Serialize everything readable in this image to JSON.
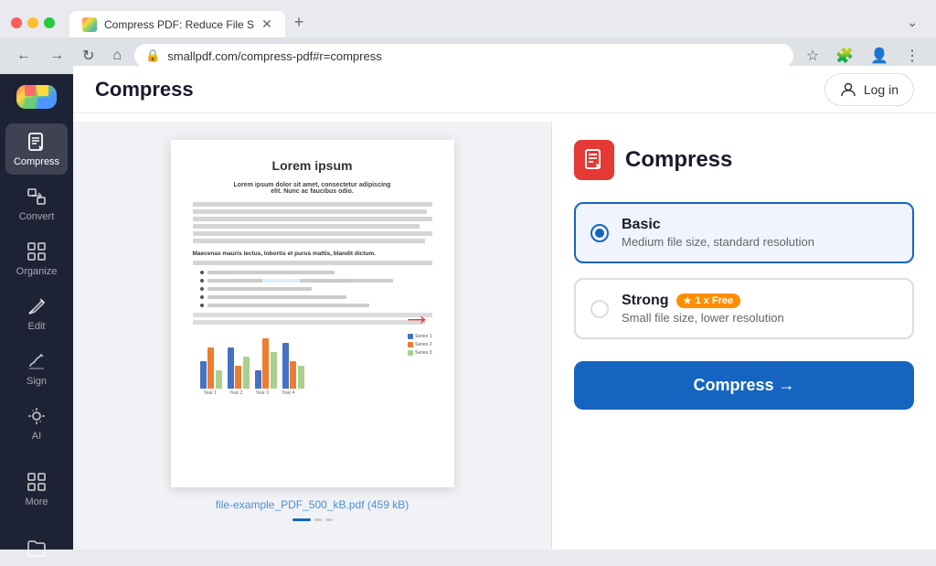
{
  "browser": {
    "tab_title": "Compress PDF: Reduce File S",
    "tab_new_label": "+",
    "url": "smallpdf.com/compress-pdf#r=compress",
    "nav": {
      "back": "←",
      "forward": "→",
      "refresh": "↻",
      "home": "⌂"
    },
    "dropdown_icon": "⌄"
  },
  "header": {
    "title": "Compress",
    "login_label": "Log in"
  },
  "sidebar": {
    "items": [
      {
        "id": "compress",
        "label": "Compress",
        "active": true
      },
      {
        "id": "convert",
        "label": "Convert",
        "active": false
      },
      {
        "id": "organize",
        "label": "Organize",
        "active": false
      },
      {
        "id": "edit",
        "label": "Edit",
        "active": false
      },
      {
        "id": "sign",
        "label": "Sign",
        "active": false
      },
      {
        "id": "ai",
        "label": "AI",
        "active": false
      },
      {
        "id": "more",
        "label": "More",
        "active": false
      },
      {
        "id": "files",
        "label": "",
        "active": false
      }
    ]
  },
  "pdf": {
    "title": "Lorem ipsum",
    "subtitle": "Lorem ipsum dolor sit amet, consectetur adipiscing elit. Nunc ac faucibus odio.",
    "filename": "file-example_PDF_500_kB.pdf (459 kB)"
  },
  "compress": {
    "icon_label": "compress-icon",
    "title": "Compress",
    "options": [
      {
        "id": "basic",
        "label": "Basic",
        "description": "Medium file size, standard resolution",
        "selected": true,
        "badge": null
      },
      {
        "id": "strong",
        "label": "Strong",
        "description": "Small file size, lower resolution",
        "selected": false,
        "badge": "★1 x Free"
      }
    ],
    "button_label": "Compress →"
  },
  "chart": {
    "groups": [
      {
        "bars": [
          {
            "color": "#4472c4",
            "height": 30
          },
          {
            "color": "#ed7d31",
            "height": 45
          },
          {
            "color": "#a9d18e",
            "height": 20
          }
        ]
      },
      {
        "bars": [
          {
            "color": "#4472c4",
            "height": 45
          },
          {
            "color": "#ed7d31",
            "height": 25
          },
          {
            "color": "#a9d18e",
            "height": 35
          }
        ]
      },
      {
        "bars": [
          {
            "color": "#4472c4",
            "height": 20
          },
          {
            "color": "#ed7d31",
            "height": 55
          },
          {
            "color": "#a9d18e",
            "height": 40
          }
        ]
      },
      {
        "bars": [
          {
            "color": "#4472c4",
            "height": 50
          },
          {
            "color": "#ed7d31",
            "height": 30
          },
          {
            "color": "#a9d18e",
            "height": 25
          }
        ]
      }
    ]
  }
}
